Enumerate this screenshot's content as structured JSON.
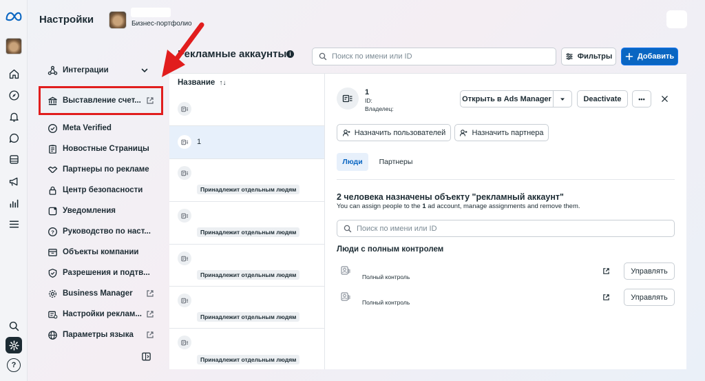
{
  "header": {
    "title": "Настройки",
    "portfolio_label": "Бизнес-портфолио"
  },
  "nav": {
    "items": [
      {
        "label": "Интеграции",
        "icon": "integrations-icon",
        "has_chevron": true
      },
      {
        "label": "Выставление счет...",
        "icon": "bank-icon",
        "external": true,
        "highlighted": true
      },
      {
        "label": "Meta Verified",
        "icon": "verified-badge-icon"
      },
      {
        "label": "Новостные Страницы",
        "icon": "news-pages-icon"
      },
      {
        "label": "Партнеры по рекламе",
        "icon": "handshake-icon"
      },
      {
        "label": "Центр безопасности",
        "icon": "lock-icon"
      },
      {
        "label": "Уведомления",
        "icon": "notification-square-icon"
      },
      {
        "label": "Руководство по наст...",
        "icon": "help-circle-icon"
      },
      {
        "label": "Объекты компании",
        "icon": "inbox-icon"
      },
      {
        "label": "Разрешения и подтв...",
        "icon": "shield-check-icon"
      },
      {
        "label": "Business Manager",
        "icon": "gear-icon",
        "external": true
      },
      {
        "label": "Настройки реклам...",
        "icon": "ad-settings-icon",
        "external": true
      },
      {
        "label": "Параметры языка",
        "icon": "globe-icon",
        "external": true
      }
    ]
  },
  "main": {
    "title": "Рекламные аккаунты",
    "search_placeholder": "Поиск по имени или ID",
    "filters_label": "Фильтры",
    "add_label": "Добавить"
  },
  "list": {
    "column_header": "Название",
    "rows": [
      {
        "name": "",
        "badge": "",
        "selected": false
      },
      {
        "name": "1",
        "badge": "",
        "selected": true
      },
      {
        "name": "",
        "badge": "Принадлежит отдельным людям",
        "selected": false
      },
      {
        "name": "",
        "badge": "Принадлежит отдельным людям",
        "selected": false
      },
      {
        "name": "",
        "badge": "Принадлежит отдельным людям",
        "selected": false
      },
      {
        "name": "",
        "badge": "Принадлежит отдельным людям",
        "selected": false
      },
      {
        "name": "",
        "badge": "Принадлежит отдельным людям",
        "selected": false
      }
    ]
  },
  "detail": {
    "name": "1",
    "id_label": "ID:",
    "owner_label": "Владелец:",
    "open_ads_manager_label": "Открыть в Ads Manager",
    "deactivate_label": "Deactivate",
    "more_label": "•••",
    "assign_users_label": "Назначить пользователей",
    "assign_partner_label": "Назначить партнера",
    "tabs": [
      {
        "label": "Люди",
        "active": true
      },
      {
        "label": "Партнеры",
        "active": false
      }
    ],
    "section_title": "2 человека назначены объекту \"рекламный аккаунт\"",
    "section_sub_before": "You can assign people to the ",
    "section_sub_count": "1",
    "section_sub_after": " ad account, manage assignments and remove them.",
    "people_search_placeholder": "Поиск по имени или ID",
    "full_control_title": "Люди с полным контролем",
    "people": [
      {
        "role": "Полный контроль",
        "manage_label": "Управлять"
      },
      {
        "role": "Полный контроль",
        "manage_label": "Управлять"
      }
    ]
  },
  "colors": {
    "accent": "#0a66c2",
    "highlight_border": "#e11d1d",
    "selected_row": "#e7f0fb",
    "text": "#1c2b33"
  }
}
